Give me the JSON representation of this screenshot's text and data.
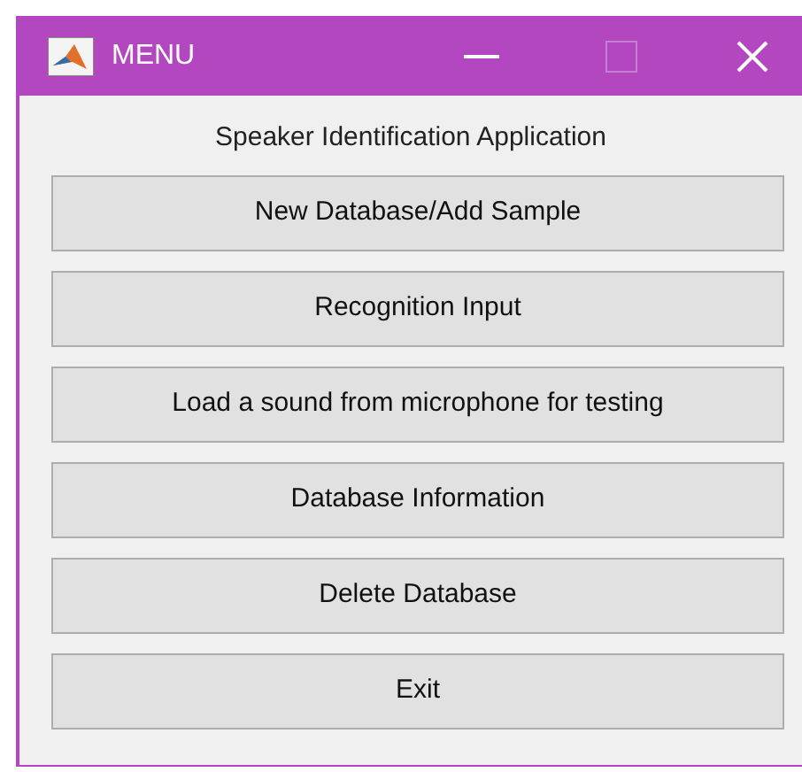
{
  "window": {
    "title": "MENU"
  },
  "heading": "Speaker Identification Application",
  "buttons": [
    "New Database/Add Sample",
    "Recognition Input",
    "Load a sound from microphone for testing",
    "Database Information",
    "Delete Database",
    "Exit"
  ]
}
